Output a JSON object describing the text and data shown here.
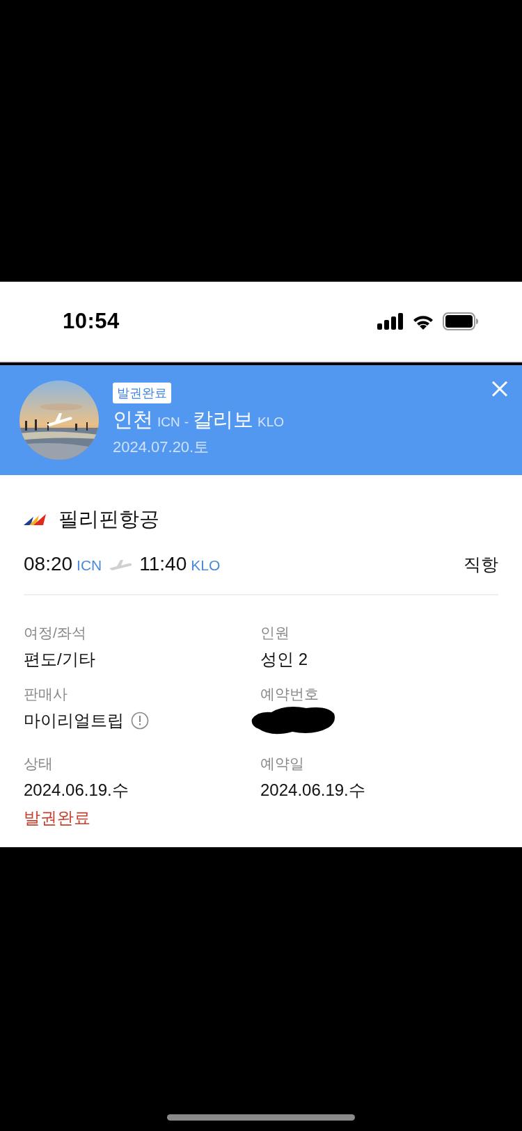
{
  "status_bar": {
    "time": "10:54"
  },
  "trip_header": {
    "badge": "발권완료",
    "origin_city": "인천",
    "origin_code": "ICN",
    "separator": "-",
    "destination_city": "칼리보",
    "destination_code": "KLO",
    "date": "2024.07.20.토"
  },
  "flight": {
    "airline": "필리핀항공",
    "departure_time": "08:20",
    "departure_code": "ICN",
    "arrival_time": "11:40",
    "arrival_code": "KLO",
    "route_type": "직항"
  },
  "details": [
    {
      "kind": "text",
      "label": "여정/좌석",
      "value": "편도/기타"
    },
    {
      "kind": "text",
      "label": "인원",
      "value": "성인 2"
    },
    {
      "kind": "info",
      "label": "판매사",
      "value": "마이리얼트립"
    },
    {
      "kind": "redacted",
      "label": "예약번호"
    },
    {
      "kind": "status",
      "label": "상태",
      "value": "2024.06.19.수",
      "status": "발권완료"
    },
    {
      "kind": "text",
      "label": "예약일",
      "value": "2024.06.19.수"
    }
  ]
}
